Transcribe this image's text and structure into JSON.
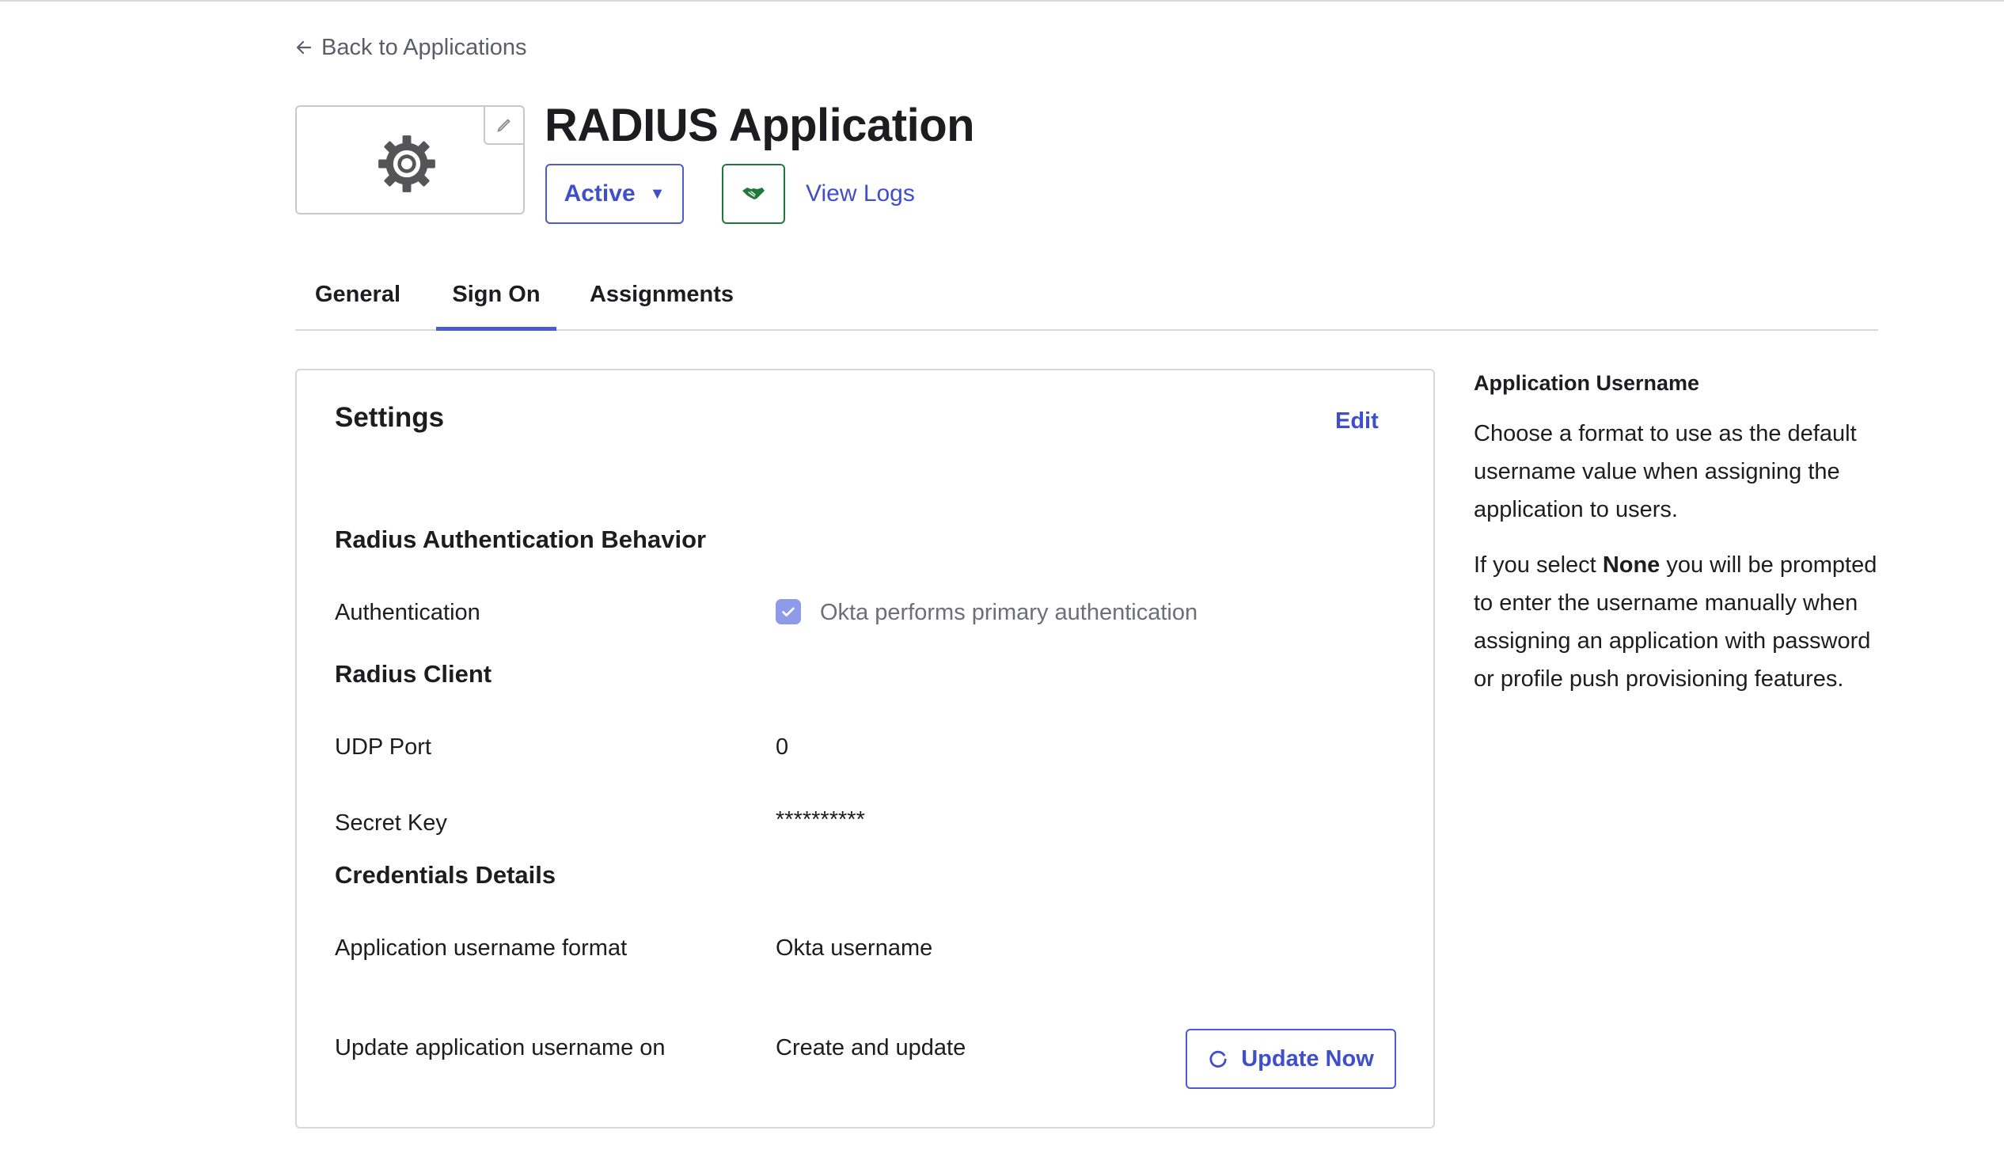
{
  "nav": {
    "back_label": "Back to Applications"
  },
  "app": {
    "title": "RADIUS Application",
    "status": "Active",
    "view_logs_label": "View Logs"
  },
  "tabs": [
    {
      "label": "General",
      "active": false
    },
    {
      "label": "Sign On",
      "active": true
    },
    {
      "label": "Assignments",
      "active": false
    }
  ],
  "settings": {
    "title": "Settings",
    "edit_label": "Edit",
    "radius_auth": {
      "title": "Radius Authentication Behavior",
      "auth_label": "Authentication",
      "auth_value": "Okta performs primary authentication",
      "auth_checked": true
    },
    "radius_client": {
      "title": "Radius Client",
      "udp_label": "UDP Port",
      "udp_value": "0",
      "secret_label": "Secret Key",
      "secret_value": "**********"
    },
    "credentials": {
      "title": "Credentials Details",
      "format_label": "Application username format",
      "format_value": "Okta username",
      "update_label": "Update application username on",
      "update_value": "Create and update",
      "update_now_label": "Update Now"
    }
  },
  "help": {
    "title": "Application Username",
    "para1": "Choose a format to use as the default username value when assigning the application to users.",
    "para2_prefix": "If you select ",
    "para2_bold": "None",
    "para2_suffix": " you will be prompted to enter the username manually when assigning an application with password or profile push provisioning features."
  },
  "colors": {
    "accent": "#4b5bd3",
    "success": "#1f7a3a",
    "border": "#d7d7dc"
  },
  "icons": {
    "back": "arrow-left-icon",
    "logo": "gear-icon",
    "logo_edit": "pencil-icon",
    "status_caret": "caret-down-icon",
    "handshake": "handshake-icon",
    "checkbox": "checkmark-icon",
    "refresh": "refresh-icon"
  }
}
